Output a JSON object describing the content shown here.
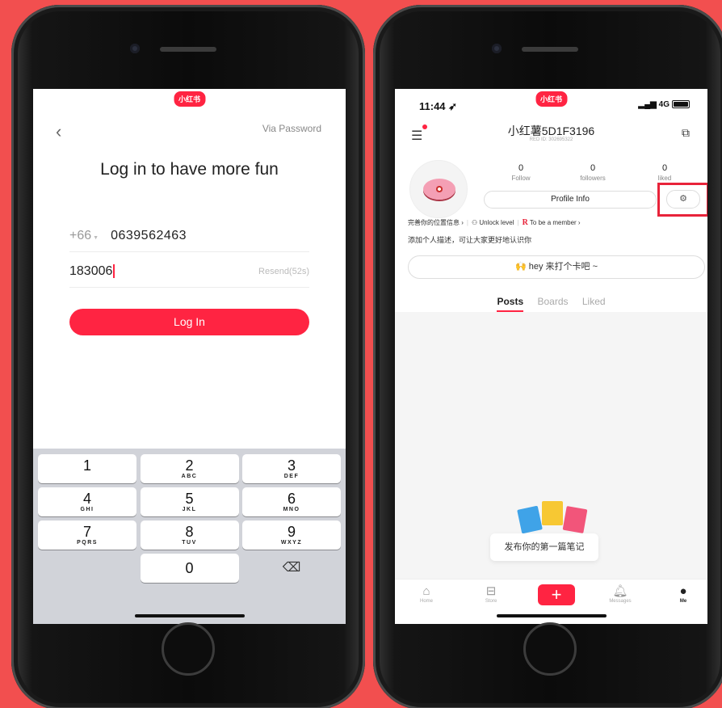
{
  "logo": "小红书",
  "login": {
    "back_icon": "chevron-left-icon",
    "via_password": "Via Password",
    "title": "Log in to have more fun",
    "country_code": "+66",
    "phone_number": "0639562463",
    "code_value": "183006",
    "resend_label": "Resend(52s)",
    "login_button": "Log In",
    "accent_color": "#ff2442"
  },
  "keypad": {
    "rows": [
      [
        {
          "num": "1",
          "sub": ""
        },
        {
          "num": "2",
          "sub": "ABC"
        },
        {
          "num": "3",
          "sub": "DEF"
        }
      ],
      [
        {
          "num": "4",
          "sub": "GHI"
        },
        {
          "num": "5",
          "sub": "JKL"
        },
        {
          "num": "6",
          "sub": "MNO"
        }
      ],
      [
        {
          "num": "7",
          "sub": "PQRS"
        },
        {
          "num": "8",
          "sub": "TUV"
        },
        {
          "num": "9",
          "sub": "WXYZ"
        }
      ]
    ],
    "zero": "0",
    "delete_icon": "backspace-icon"
  },
  "profile": {
    "status_time": "11:44",
    "network": "4G",
    "username": "小红薯5D1F3196",
    "red_id": "RED ID: 302695322",
    "stats": [
      {
        "value": "0",
        "label": "Follow"
      },
      {
        "value": "0",
        "label": "followers"
      },
      {
        "value": "0",
        "label": "liked"
      }
    ],
    "profile_info_button": "Profile Info",
    "location_prompt": "完善你的位置信息 ›",
    "unlock_level": "Unlock level",
    "member_badge": "R",
    "member_label": "To be a member ›",
    "bio_prompt": "添加个人描述，可让大家更好地认识你",
    "checkin_button": "🙌 hey 来打个卡吧 ~",
    "tabs": [
      "Posts",
      "Boards",
      "Liked"
    ],
    "active_tab": "Posts",
    "first_note": "发布你的第一篇笔记",
    "highlight_color": "#e8233a"
  },
  "tabbar": {
    "home": "Home",
    "store": "Store",
    "messages": "Messages",
    "me": "Me"
  }
}
